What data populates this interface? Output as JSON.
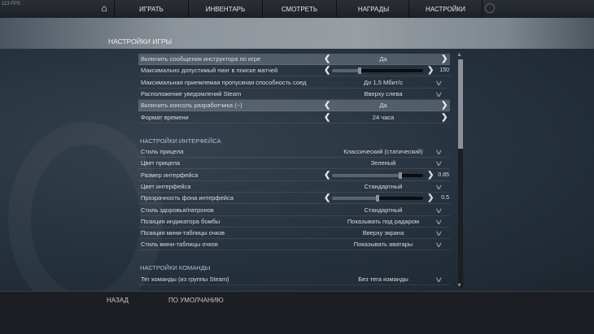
{
  "fps": "113 FPS",
  "nav": {
    "tabs": [
      "ИГРАТЬ",
      "ИНВЕНТАРЬ",
      "СМОТРЕТЬ",
      "НАГРАДЫ",
      "НАСТРОЙКИ"
    ]
  },
  "title": "НАСТРОЙКИ ИГРЫ",
  "game": [
    {
      "label": "Включить сообщения инструктора по игре",
      "type": "toggle",
      "value": "Да",
      "highlight": true
    },
    {
      "label": "Максимально допустимый пинг в поиске матчей",
      "type": "slider",
      "value": "150",
      "fraction": 0.3
    },
    {
      "label": "Максимальная приемлемая пропускная способность соед",
      "type": "dropdown",
      "value": "До 1,5 Мбит/с"
    },
    {
      "label": "Расположение уведомлений Steam",
      "type": "dropdown",
      "value": "Вверху слева"
    },
    {
      "label": "Включить консоль разработчика (~)",
      "type": "toggle",
      "value": "Да",
      "highlight": true
    },
    {
      "label": "Формат времени",
      "type": "toggle",
      "value": "24 часа"
    }
  ],
  "interface_title": "НАСТРОЙКИ ИНТЕРФЕЙСА",
  "interface": [
    {
      "label": "Стиль прицела",
      "type": "dropdown",
      "value": "Классический (статический)"
    },
    {
      "label": "Цвет прицела",
      "type": "dropdown",
      "value": "Зеленый"
    },
    {
      "label": "Размер интерфейса",
      "type": "slider",
      "value": "0.85",
      "fraction": 0.75
    },
    {
      "label": "Цвет интерфейса",
      "type": "dropdown",
      "value": "Стандартный"
    },
    {
      "label": "Прозрачность фона интерфейса",
      "type": "slider",
      "value": "0.5",
      "fraction": 0.5
    },
    {
      "label": "Стиль здоровья/патронов",
      "type": "dropdown",
      "value": "Стандартный"
    },
    {
      "label": "Позиция индикатора бомбы",
      "type": "dropdown",
      "value": "Показывать под радаром"
    },
    {
      "label": "Позиция мини-таблицы очков",
      "type": "dropdown",
      "value": "Вверху экрана"
    },
    {
      "label": "Стиль мини-таблицы очков",
      "type": "dropdown",
      "value": "Показывать аватары"
    }
  ],
  "team_title": "НАСТРОЙКИ КОМАНДЫ",
  "team": [
    {
      "label": "Тег команды (из группы Steam)",
      "type": "dropdown",
      "value": "Без тега команды"
    }
  ],
  "bottom": {
    "back": "НАЗАД",
    "defaults": "ПО УМОЛЧАНИЮ"
  }
}
